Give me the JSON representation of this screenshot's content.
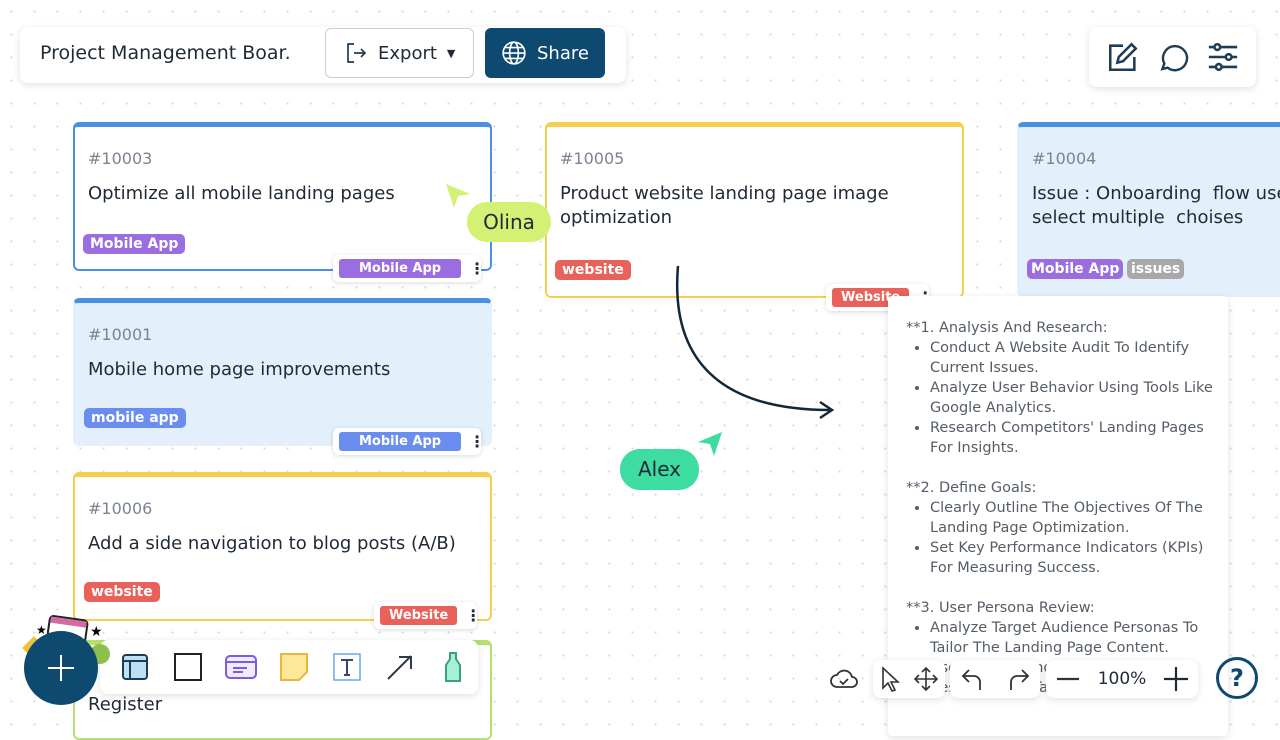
{
  "header": {
    "title": "Project Management Boar.",
    "export_label": "Export",
    "share_label": "Share"
  },
  "top_right_icons": [
    "edit-icon",
    "comment-icon",
    "settings-sliders-icon"
  ],
  "colors": {
    "primary": "#0e4a6f",
    "blue": "#4a90e2",
    "yellow": "#f5d04e",
    "green": "#b5e06a",
    "purple": "#9a6ee0",
    "red": "#e8615a",
    "gray": "#a8a8a8"
  },
  "cards": [
    {
      "id": "#10003",
      "title": "Optimize all mobile landing pages",
      "tag": "Mobile App",
      "chip": "Mobile App"
    },
    {
      "id": "#10001",
      "title": "Mobile home page improvements",
      "tag": "mobile app",
      "chip": "Mobile App"
    },
    {
      "id": "#10006",
      "title": "Add a side navigation to blog posts (A/B)",
      "tag": "website",
      "chip": "Website"
    },
    {
      "title": "Register"
    },
    {
      "id": "#10005",
      "title": "Product website landing page image optimization",
      "tag": "website",
      "chip": "Website"
    },
    {
      "id": "#10004",
      "title": "Issue : Onboarding  flow users select multiple  choises",
      "tags": [
        "Mobile App",
        "issues"
      ]
    }
  ],
  "notes": {
    "s1": "**1. Analysis And Research:",
    "s1_items": [
      "Conduct A Website Audit To Identify Current Issues.",
      "Analyze User Behavior Using Tools Like Google Analytics.",
      "Research Competitors' Landing Pages For Insights."
    ],
    "s2": "**2. Define Goals:",
    "s2_items": [
      "Clearly Outline The Objectives Of The Landing Page Optimization.",
      "Set Key Performance Indicators (KPIs) For Measuring Success."
    ],
    "s3": "**3. User Persona Review:",
    "s3_items": [
      "Analyze Target Audience Personas To Tailor The Landing Page Content.",
      "Use Surveys And Interviews To Research The Target Audience."
    ]
  },
  "cursors": [
    {
      "name": "Olina",
      "color": "#d4f075"
    },
    {
      "name": "Alex",
      "color": "#3ddca0"
    }
  ],
  "bottom_toolbar": [
    "table-icon",
    "rectangle-icon",
    "card-icon",
    "sticky-note-icon",
    "text-icon",
    "arrow-icon",
    "marker-icon"
  ],
  "zoom": {
    "level": "100%"
  }
}
